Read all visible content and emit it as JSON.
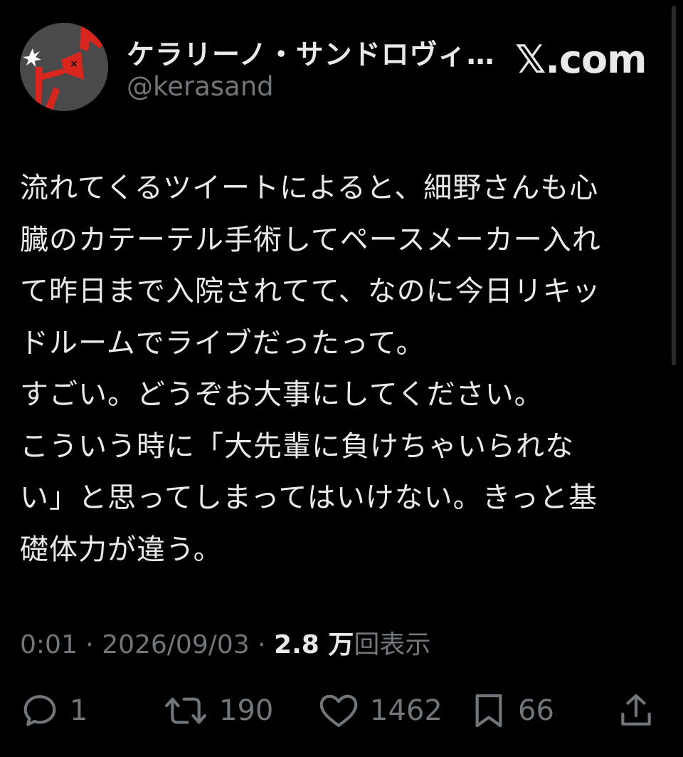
{
  "author": {
    "display_name": "ケラリーノ・サンドロヴィ…",
    "handle": "@kerasand",
    "avatar_icon": "megaphone-figure-avatar"
  },
  "brand": "𝕏.com",
  "tweet": {
    "lines": [
      "流れてくるツイートによると、細野さんも心",
      "臓のカテーテル手術してペースメーカー入れ",
      "て昨日まで入院されてて、なのに今日リキッ",
      "ドルームでライブだったって。",
      "すごい。どうぞお大事にしてください。",
      "こういう時に「大先輩に負けちゃいられな",
      "い」と思ってしまってはいけない。きっと基",
      "礎体力が違う。"
    ]
  },
  "meta": {
    "time": "0:01",
    "separator": " · ",
    "date": "2026/09/03",
    "views_count": "2.8 万",
    "views_label": "回表示"
  },
  "actions": {
    "reply": {
      "icon": "reply-icon",
      "count": "1"
    },
    "retweet": {
      "icon": "retweet-icon",
      "count": "190"
    },
    "like": {
      "icon": "heart-icon",
      "count": "1462"
    },
    "bookmark": {
      "icon": "bookmark-icon",
      "count": "66"
    },
    "share": {
      "icon": "share-icon"
    }
  },
  "colors": {
    "background": "#000000",
    "text": "#e7e9ea",
    "muted": "#71767b",
    "avatar_red": "#d8261f"
  }
}
